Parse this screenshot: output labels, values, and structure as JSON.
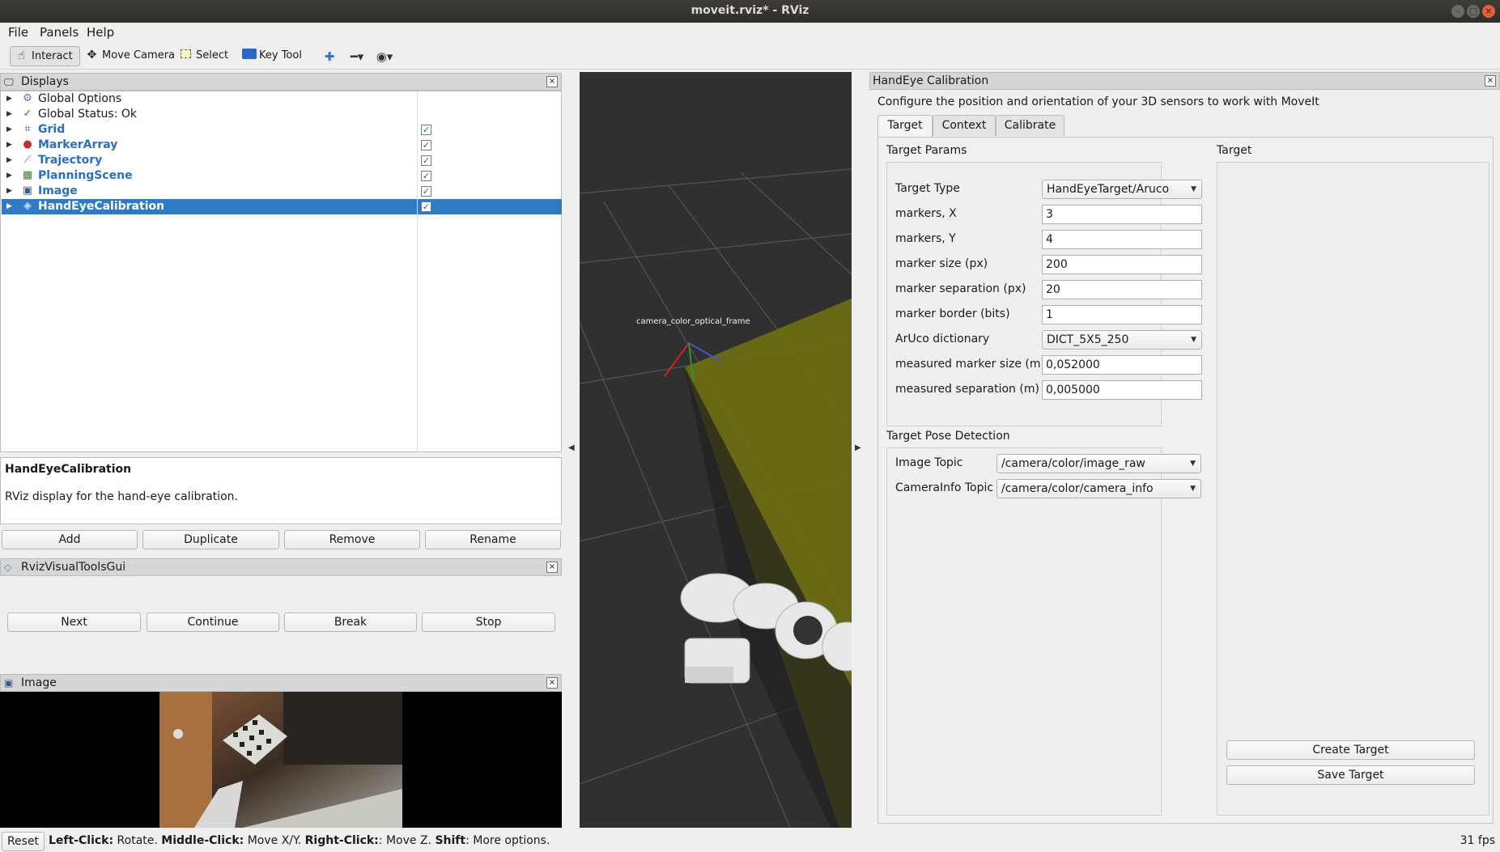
{
  "window": {
    "title": "moveit.rviz* - RViz"
  },
  "menu": [
    "File",
    "Panels",
    "Help"
  ],
  "toolbar": {
    "interact": "Interact",
    "move_camera": "Move Camera",
    "select": "Select",
    "key_tool": "Key Tool"
  },
  "displays": {
    "title": "Displays",
    "items": [
      {
        "label": "Global Options",
        "icon": "gear-icon"
      },
      {
        "label": "Global Status: Ok",
        "icon": "check-icon"
      },
      {
        "label": "Grid",
        "icon": "grid-icon",
        "checked": true
      },
      {
        "label": "MarkerArray",
        "icon": "marker-icon",
        "checked": true
      },
      {
        "label": "Trajectory",
        "icon": "trajectory-icon",
        "checked": true
      },
      {
        "label": "PlanningScene",
        "icon": "planning-icon",
        "checked": true
      },
      {
        "label": "Image",
        "icon": "image-icon",
        "checked": true
      },
      {
        "label": "HandEyeCalibration",
        "icon": "handeye-icon",
        "checked": true,
        "selected": true
      }
    ],
    "description_title": "HandEyeCalibration",
    "description_text": "RViz display for the hand-eye calibration.",
    "buttons": {
      "add": "Add",
      "duplicate": "Duplicate",
      "remove": "Remove",
      "rename": "Rename"
    }
  },
  "visual_tools": {
    "title": "RvizVisualToolsGui",
    "buttons": {
      "next": "Next",
      "continue": "Continue",
      "break": "Break",
      "stop": "Stop"
    }
  },
  "image_panel": {
    "title": "Image"
  },
  "viewport": {
    "frame_label": "camera_color_optical_frame"
  },
  "handeye": {
    "title": "HandEye Calibration",
    "description": "Configure the position and orientation of your 3D sensors to work with MoveIt",
    "tabs": [
      "Target",
      "Context",
      "Calibrate"
    ],
    "active_tab": "Target",
    "target_params": {
      "title": "Target Params",
      "target_type_label": "Target Type",
      "target_type_value": "HandEyeTarget/Aruco",
      "markers_x_label": "markers, X",
      "markers_x_value": "3",
      "markers_y_label": "markers, Y",
      "markers_y_value": "4",
      "marker_size_label": "marker size (px)",
      "marker_size_value": "200",
      "marker_sep_label": "marker separation (px)",
      "marker_sep_value": "20",
      "marker_border_label": "marker border (bits)",
      "marker_border_value": "1",
      "aruco_dict_label": "ArUco dictionary",
      "aruco_dict_value": "DICT_5X5_250",
      "measured_size_label": "measured marker size (m)",
      "measured_size_value": "0,052000",
      "measured_sep_label": "measured separation (m)",
      "measured_sep_value": "0,005000"
    },
    "pose_detection": {
      "title": "Target Pose Detection",
      "image_topic_label": "Image Topic",
      "image_topic_value": "/camera/color/image_raw",
      "camera_info_label": "CameraInfo Topic",
      "camera_info_value": "/camera/color/camera_info"
    },
    "target_preview": {
      "title": "Target"
    },
    "buttons": {
      "create": "Create Target",
      "save": "Save Target"
    }
  },
  "status": {
    "reset": "Reset",
    "left_click": "Left-Click:",
    "left_click_action": " Rotate. ",
    "middle_click": "Middle-Click:",
    "middle_click_action": " Move X/Y. ",
    "right_click": "Right-Click:",
    "right_click_action": ": Move Z. ",
    "shift": "Shift",
    "shift_action": ": More options.",
    "fps": "31 fps"
  },
  "colors": {
    "selection": "#2f7ac7",
    "link": "#2a6ec6",
    "viewport_bg": "#303030",
    "camera_frustum": "#6b6b14"
  }
}
